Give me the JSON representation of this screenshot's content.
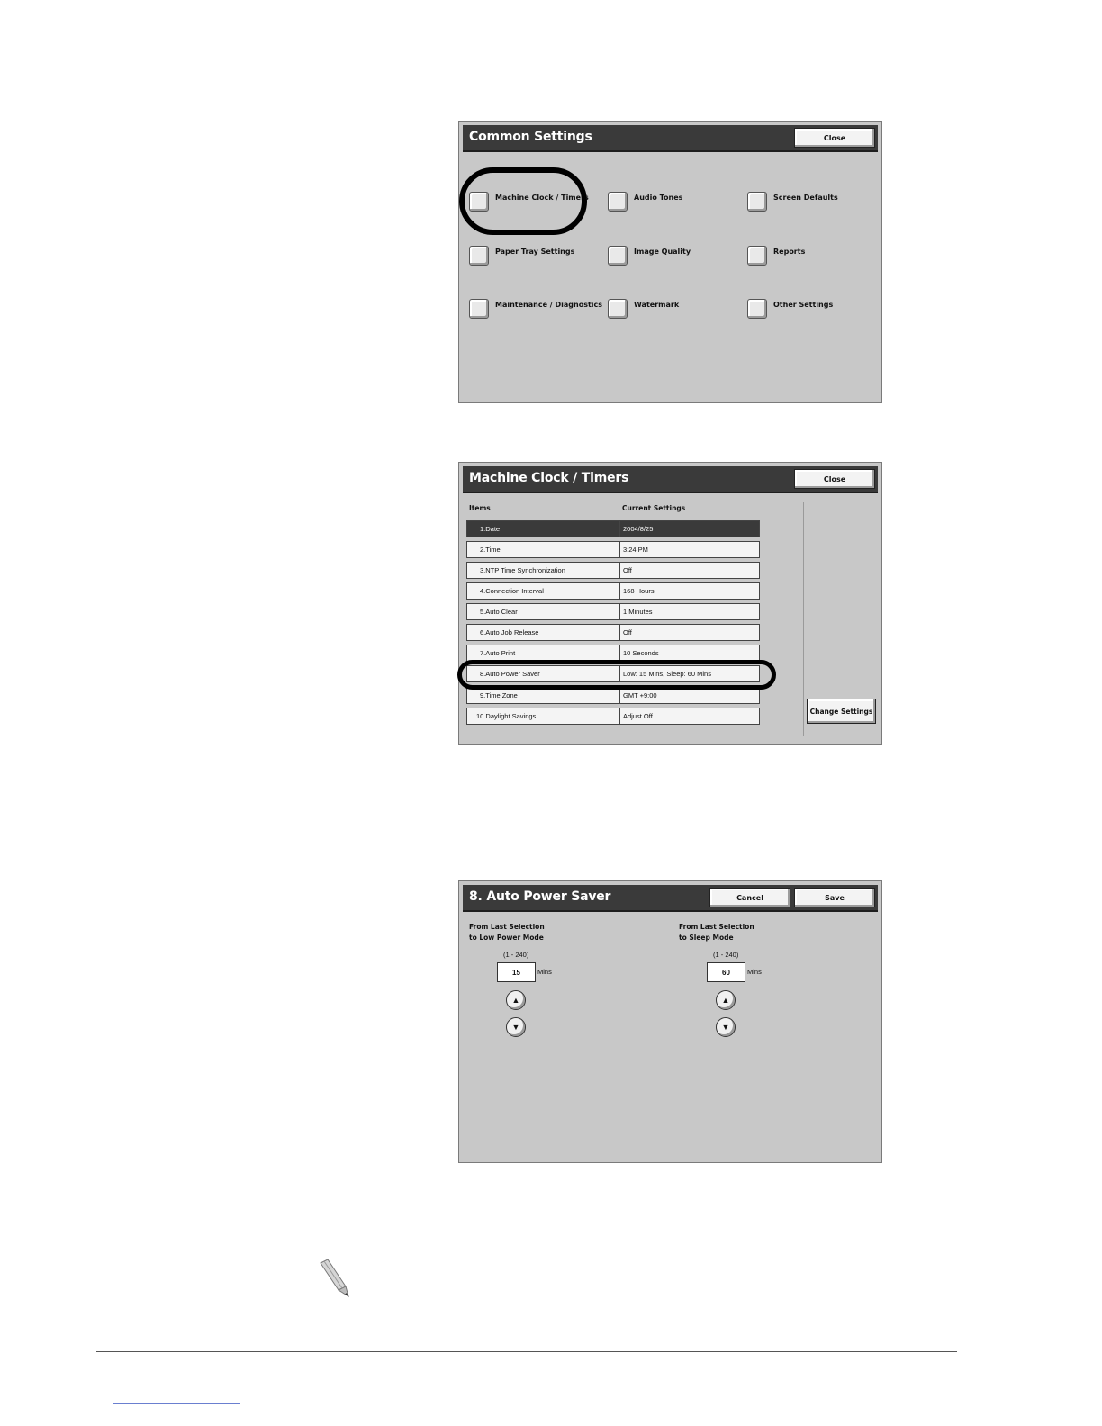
{
  "common_settings": {
    "title": "Common Settings",
    "close_label": "Close",
    "items": [
      {
        "label": "Machine Clock / Timers"
      },
      {
        "label": "Audio Tones"
      },
      {
        "label": "Screen Defaults"
      },
      {
        "label": "Paper Tray Settings"
      },
      {
        "label": "Image Quality"
      },
      {
        "label": "Reports"
      },
      {
        "label": "Maintenance / Diagnostics"
      },
      {
        "label": "Watermark"
      },
      {
        "label": "Other Settings"
      }
    ]
  },
  "clock_timers": {
    "title": "Machine Clock / Timers",
    "close_label": "Close",
    "col_items": "Items",
    "col_current": "Current Settings",
    "change_label": "Change Settings",
    "rows": [
      {
        "item": "1.Date",
        "value": "2004/8/25"
      },
      {
        "item": "2.Time",
        "value": "3:24 PM"
      },
      {
        "item": "3.NTP Time Synchronization",
        "value": "Off"
      },
      {
        "item": "4.Connection Interval",
        "value": "168 Hours"
      },
      {
        "item": "5.Auto Clear",
        "value": "1 Minutes"
      },
      {
        "item": "6.Auto Job Release",
        "value": "Off"
      },
      {
        "item": "7.Auto Print",
        "value": "10 Seconds"
      },
      {
        "item": "8.Auto Power Saver",
        "value": "Low: 15 Mins, Sleep: 60 Mins"
      },
      {
        "item": "9.Time Zone",
        "value": "GMT +9:00"
      },
      {
        "item": "10.Daylight Savings",
        "value": "Adjust Off"
      }
    ]
  },
  "power_saver": {
    "title": "8. Auto Power Saver",
    "cancel_label": "Cancel",
    "save_label": "Save",
    "low": {
      "label_line1": "From Last Selection",
      "label_line2": "to Low Power Mode",
      "range": "(1 - 240)",
      "value": "15",
      "unit": "Mins"
    },
    "sleep": {
      "label_line1": "From Last Selection",
      "label_line2": "to Sleep Mode",
      "range": "(1 - 240)",
      "value": "60",
      "unit": "Mins"
    }
  }
}
